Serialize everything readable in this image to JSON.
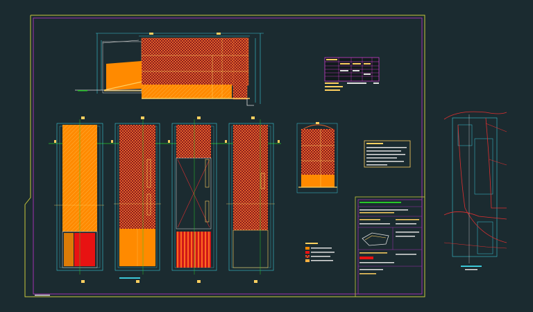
{
  "drawing": {
    "background": "#1b2b30",
    "colors": {
      "frame_outer": "#c8c83c",
      "frame_inner": "#a030b0",
      "dimension": "#3cc8d8",
      "axis": "#28c828",
      "fill_orange": "#ff8a00",
      "fill_red_hatch": "#9a1a1a",
      "fill_red": "#ee1010",
      "floor_line": "#ffd060",
      "table_border": "#e040e0",
      "site_line": "#e03030",
      "white_line": "#e0e0e0"
    },
    "drawings": [
      "section-elevation",
      "floor-plan-1",
      "floor-plan-2",
      "floor-plan-3",
      "floor-plan-4",
      "cross-section",
      "area-table",
      "notes-box",
      "legend",
      "title-block",
      "site-plan"
    ],
    "hatch_patterns": [
      "checker-red",
      "diagonal-orange"
    ]
  }
}
